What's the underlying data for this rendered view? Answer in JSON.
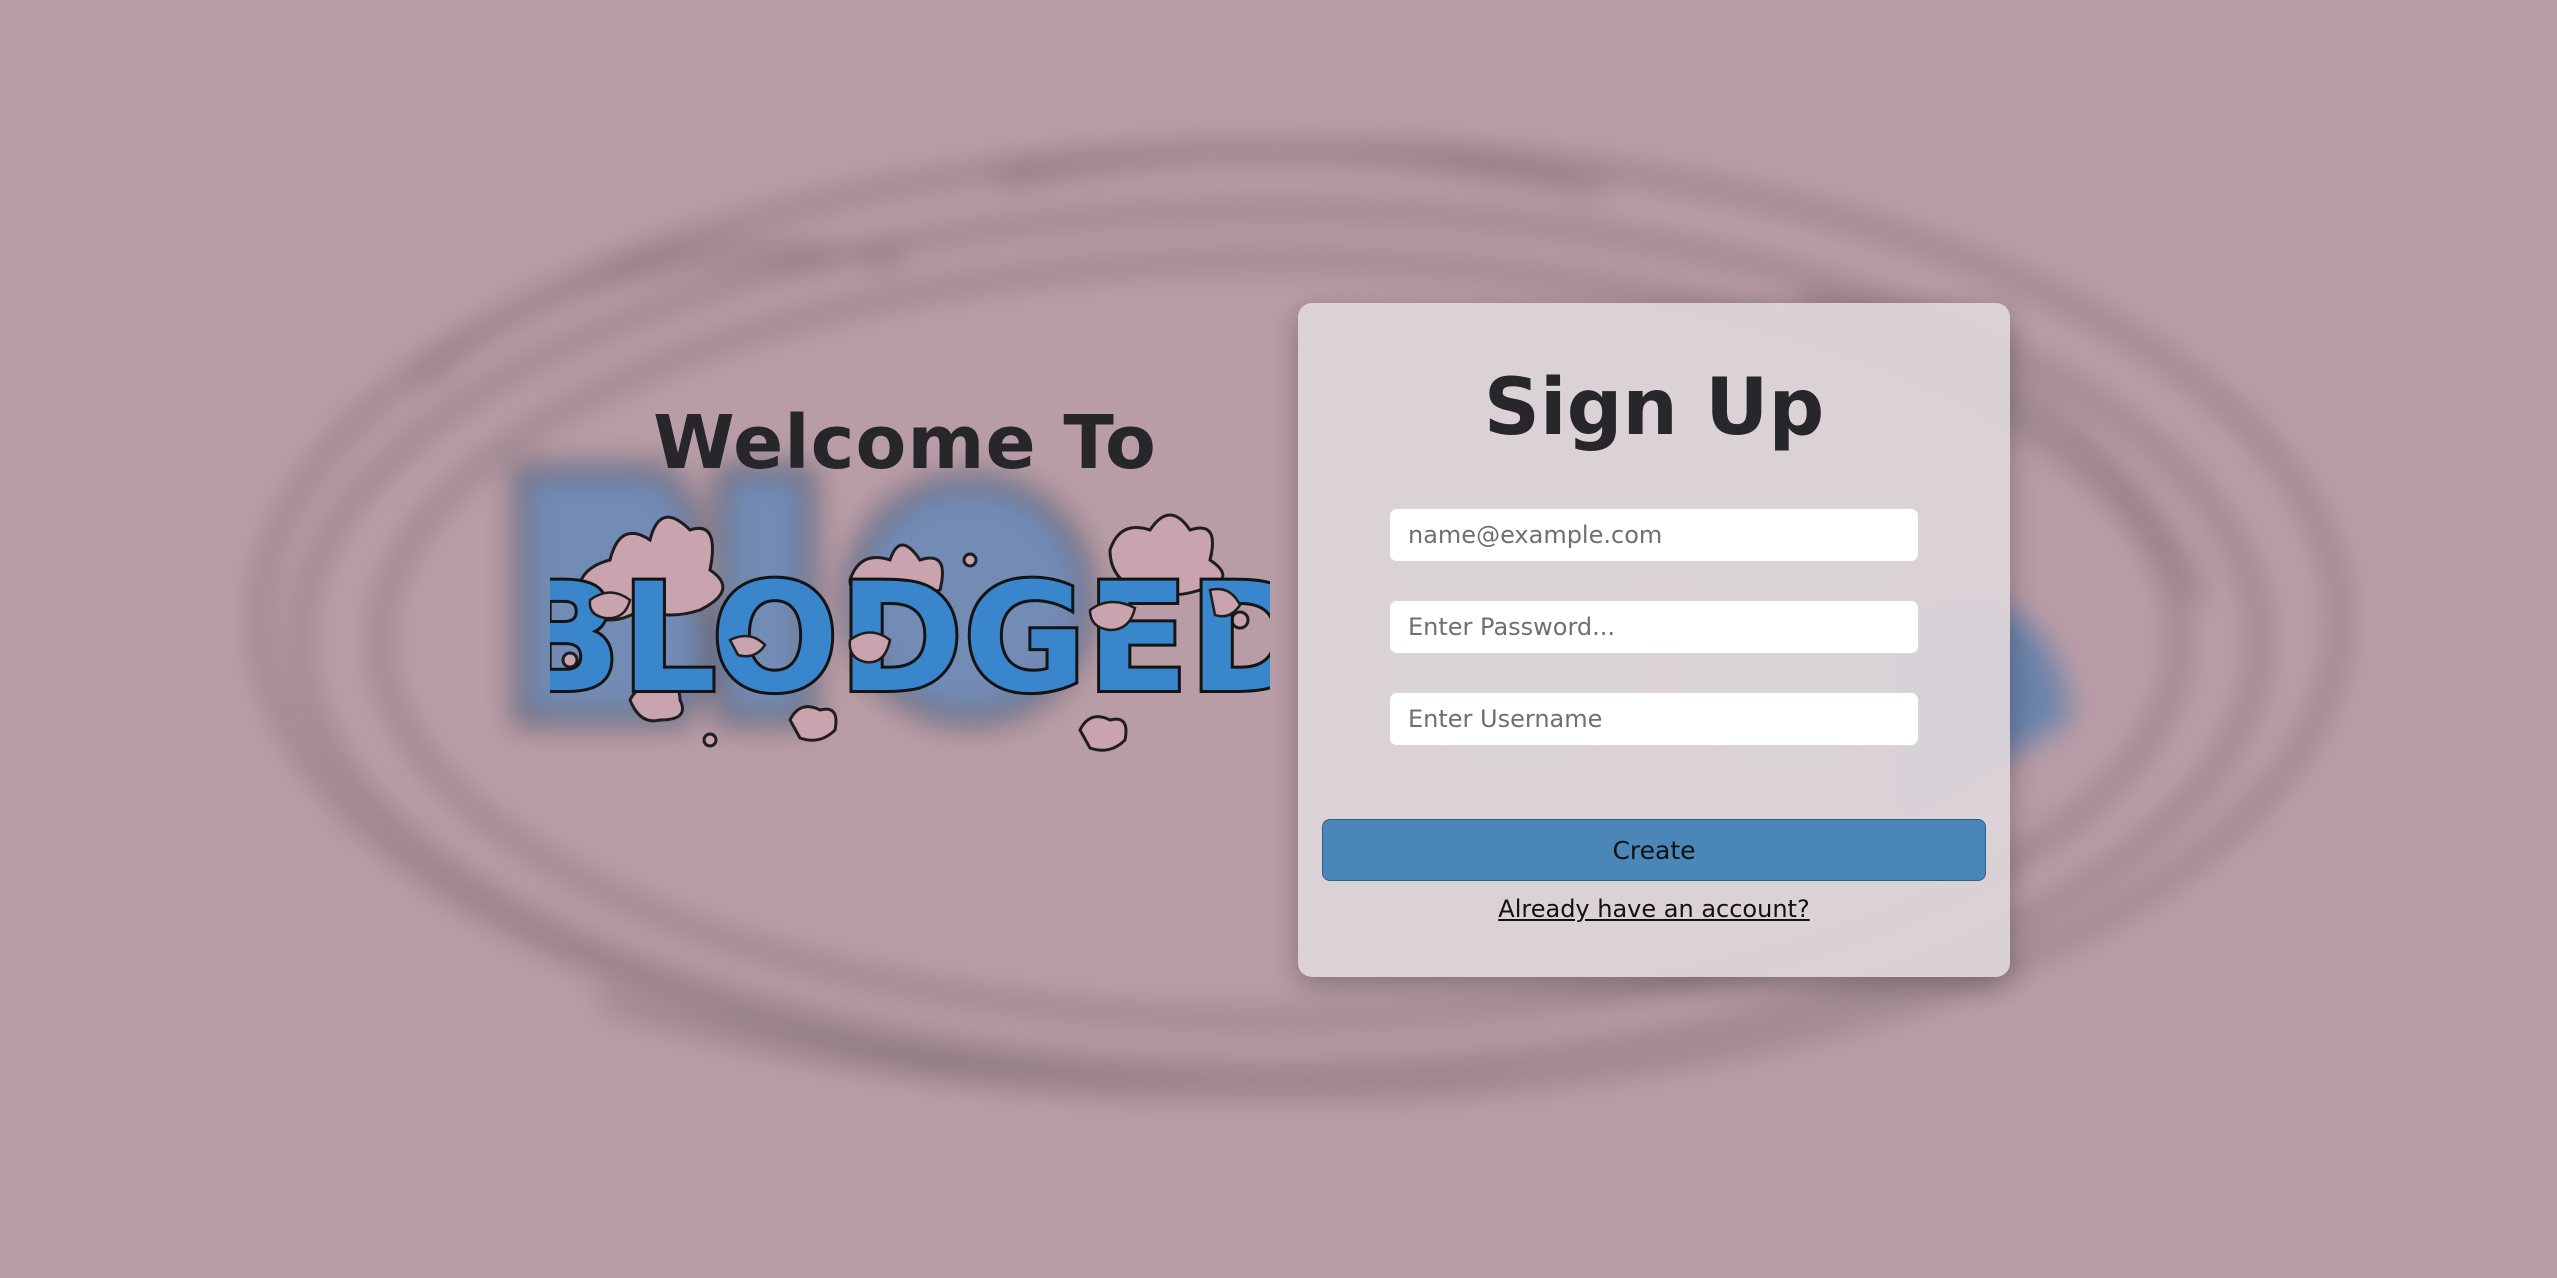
{
  "welcome": {
    "title": "Welcome To",
    "logo_text": "BLODGED"
  },
  "signup": {
    "title": "Sign Up",
    "email_placeholder": "name@example.com",
    "email_value": "",
    "password_placeholder": "Enter Password...",
    "password_value": "",
    "username_placeholder": "Enter Username",
    "username_value": "",
    "create_label": "Create",
    "login_link": "Already have an account?"
  },
  "colors": {
    "background": "#b89ca6",
    "card": "#ded6da",
    "button": "#4a86b8",
    "logo_blue": "#3a86cc",
    "splat": "#c9a3ad",
    "text_dark": "#26262b"
  },
  "icons": {
    "logo": "blodged-logo",
    "background": "blurred-logo-background"
  }
}
